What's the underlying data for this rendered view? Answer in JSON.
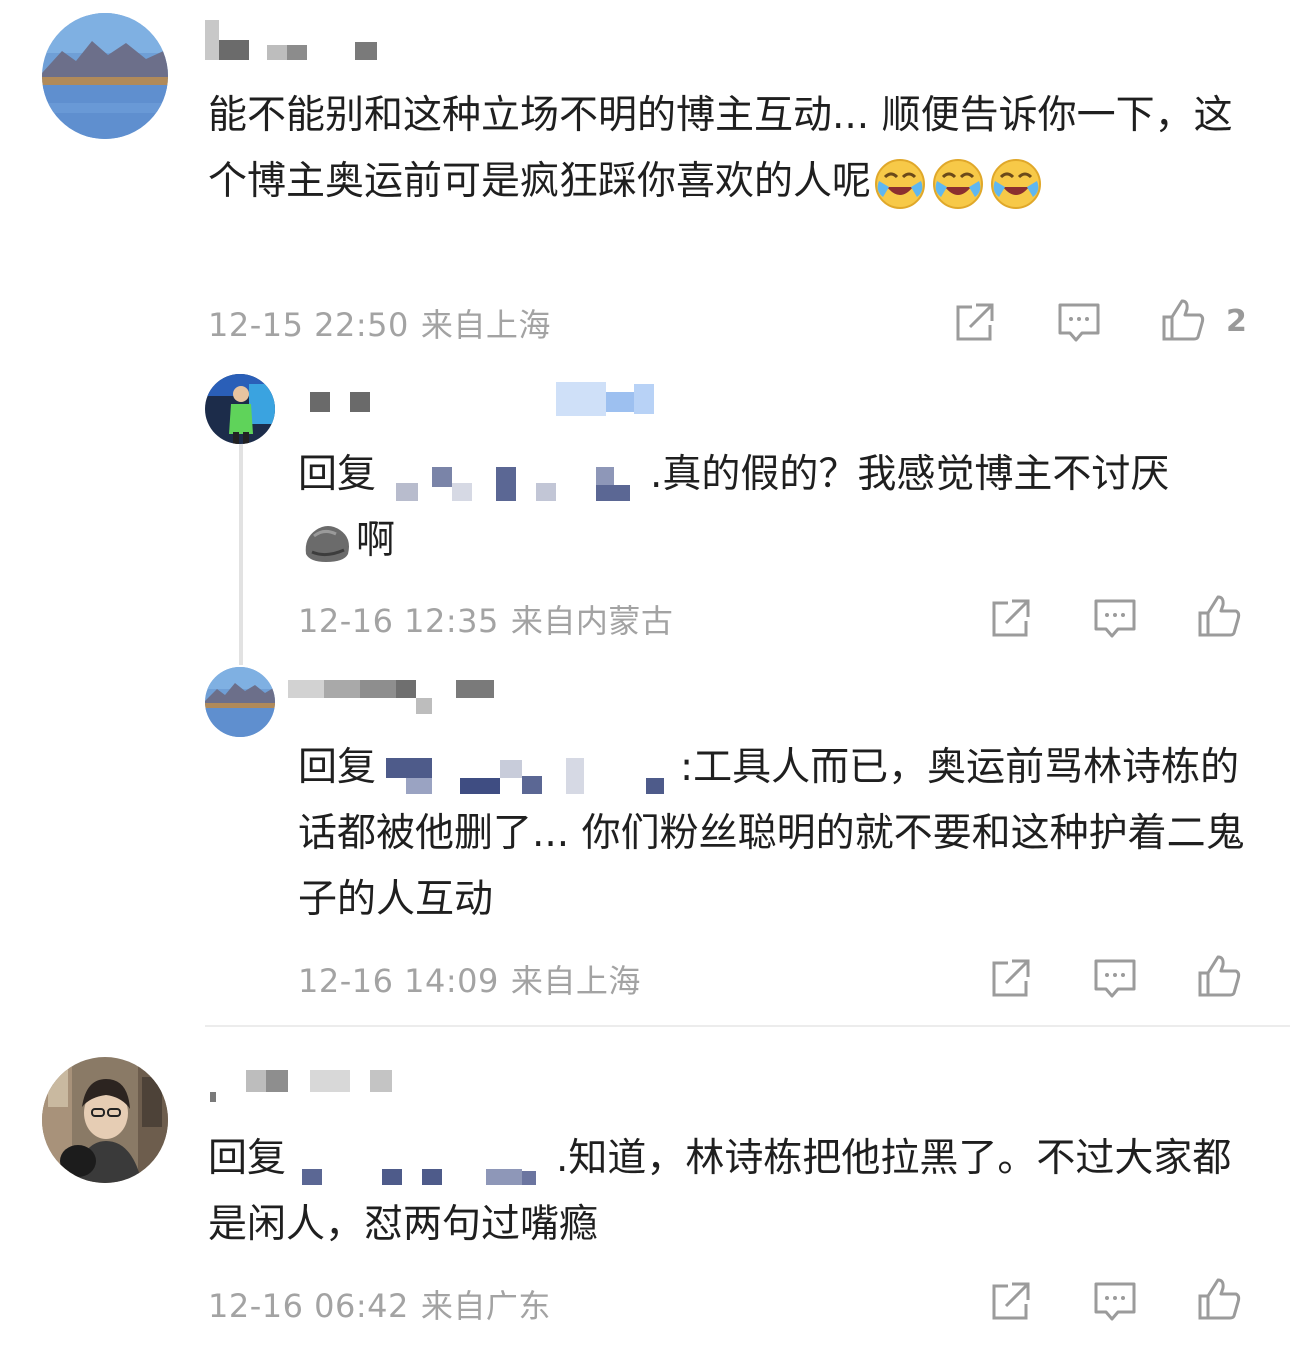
{
  "comments": [
    {
      "text": "能不能别和这种立场不明的博主互动... 顺便告诉你一下，这个博主奥运前可是疯狂踩你喜欢的人呢",
      "timestamp": "12-15 22:50",
      "location": "来自上海",
      "likes": "2",
      "emoji": "laugh-cry"
    },
    {
      "prefix": "回复",
      "text": ".真的假的？我感觉博主不讨厌",
      "text2": "啊",
      "timestamp": "12-16 12:35",
      "location": "来自内蒙古",
      "emoji": "rock"
    },
    {
      "prefix": "回复",
      "text": ":工具人而已，奥运前骂林诗栋的话都被他删了... 你们粉丝聪明的就不要和这种护着二鬼子的人互动",
      "timestamp": "12-16 14:09",
      "location": "来自上海"
    },
    {
      "prefix": "回复",
      "text": ".知道，林诗栋把他拉黑了。不过大家都是闲人，怼两句过嘴瘾",
      "timestamp": "12-16 06:42",
      "location": "来自广东"
    }
  ],
  "colors": {
    "meta_gray": "#a3a3a3",
    "icon_gray": "#9b9b9b",
    "thread_line": "#e2e2e2"
  },
  "icons": [
    "share-icon",
    "comment-icon",
    "like-icon",
    "laugh-cry-emoji",
    "rock-emoji"
  ]
}
